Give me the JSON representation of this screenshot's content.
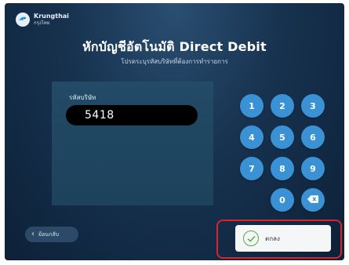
{
  "brand": {
    "name_en": "Krungthai",
    "name_th": "กรุงไทย"
  },
  "header": {
    "title": "หักบัญชีอัตโนมัติ Direct Debit",
    "subtitle": "โปรดระบุรหัสบริษัทที่ต้องการทำรายการ"
  },
  "form": {
    "code_label": "รหัสบริษัท",
    "code_value": "5418"
  },
  "keypad": {
    "keys": [
      "1",
      "2",
      "3",
      "4",
      "5",
      "6",
      "7",
      "8",
      "9",
      "0"
    ],
    "backspace_icon": "backspace-icon"
  },
  "footer": {
    "back_label": "ย้อนกลับ",
    "ok_label": "ตกลง"
  },
  "colors": {
    "key_blue": "#3a92d4",
    "highlight_red": "#d8242a",
    "check_green": "#5aa83e"
  }
}
